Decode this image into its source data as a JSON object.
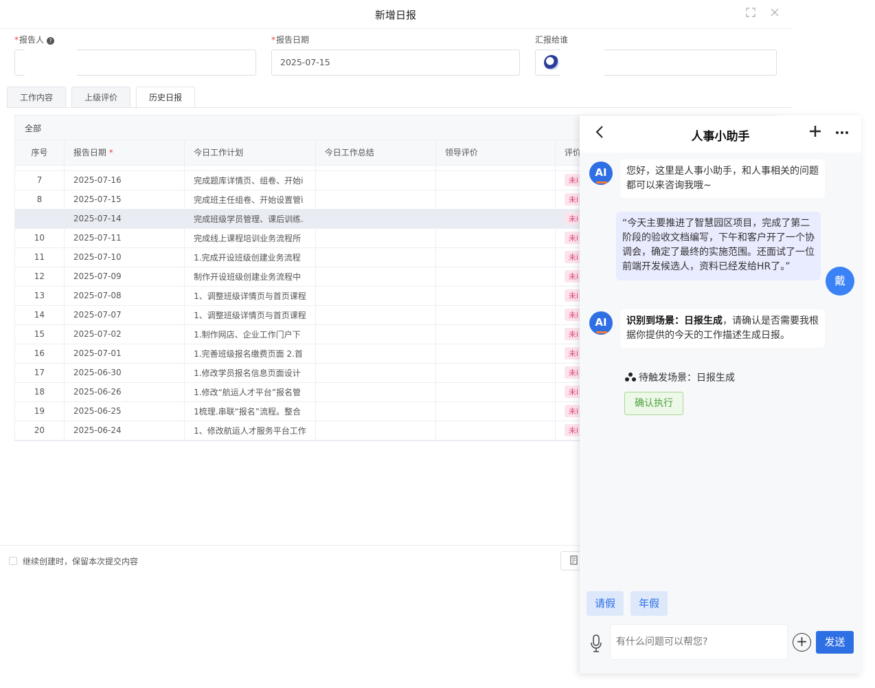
{
  "modal": {
    "title": "新增日报",
    "fields": {
      "reporter_label": "报告人",
      "report_date_label": "报告日期",
      "report_date_value": "2025-07-15",
      "report_to_label": "汇报给谁"
    },
    "tabs": [
      {
        "label": "工作内容"
      },
      {
        "label": "上级评价"
      },
      {
        "label": "历史日报"
      }
    ],
    "table": {
      "filter_label": "全部",
      "headers": [
        "序号",
        "报告日期",
        "今日工作计划",
        "今日工作总结",
        "领导评价",
        "评价"
      ],
      "rows": [
        {
          "no": "7",
          "date": "2025-07-16",
          "plan": "完成题库详情页、组卷、开始i",
          "status": "未i"
        },
        {
          "no": "8",
          "date": "2025-07-15",
          "plan": "完成班主任组卷、开始设置管ì",
          "status": "未i"
        },
        {
          "no": "",
          "date": "2025-07-14",
          "plan": "完成班级学员管理、课后训练.",
          "status": "未i"
        },
        {
          "no": "10",
          "date": "2025-07-11",
          "plan": "完成线上课程培训业务流程所",
          "status": "未i"
        },
        {
          "no": "11",
          "date": "2025-07-10",
          "plan": "1.完成开设班级创建业务流程",
          "status": "未i"
        },
        {
          "no": "12",
          "date": "2025-07-09",
          "plan": "制作开设班级创建业务流程中",
          "status": "未i"
        },
        {
          "no": "13",
          "date": "2025-07-08",
          "plan": "1、调整班级详情页与首页课程",
          "status": "未i"
        },
        {
          "no": "14",
          "date": "2025-07-07",
          "plan": "1、调整班级详情页与首页课程",
          "status": "未i"
        },
        {
          "no": "15",
          "date": "2025-07-02",
          "plan": "1.制作网店、企业工作门户下",
          "status": "未i"
        },
        {
          "no": "16",
          "date": "2025-07-01",
          "plan": "1.完善班级报名缴费页面 2.首",
          "status": "未i"
        },
        {
          "no": "17",
          "date": "2025-06-30",
          "plan": "1.修改学员报名信息页面设计",
          "status": "未i"
        },
        {
          "no": "18",
          "date": "2025-06-26",
          "plan": "1.修改“航运人才平台”报名管",
          "status": "未i"
        },
        {
          "no": "19",
          "date": "2025-06-25",
          "plan": "1梳理.串联“报名”流程。整合",
          "status": "未i"
        },
        {
          "no": "20",
          "date": "2025-06-24",
          "plan": "1、修改航运人才服务平台工作",
          "status": "未i"
        }
      ]
    },
    "footer": {
      "keep_label": "继续创建时，保留本次提交内容"
    }
  },
  "assistant": {
    "title": "人事小助手",
    "ai_avatar_text": "AI",
    "user_avatar_text": "戴",
    "messages": {
      "greeting": "您好，这里是人事小助手，和人事相关的问题都可以来咨询我哦~",
      "user_msg": "“今天主要推进了智慧园区项目，完成了第二阶段的验收文档编写，下午和客户开了一个协调会，确定了最终的实施范围。还面试了一位前端开发候选人，资料已经发给HR了。”",
      "scene_prefix": "识别到场景：日报生成",
      "scene_rest": "，请确认是否需要我根据你提供的今天的工作描述生成日报。"
    },
    "pending_label": "待触发场景：日报生成",
    "confirm_label": "确认执行",
    "quick_actions": [
      "请假",
      "年假"
    ],
    "input_placeholder": "有什么问题可以帮您?",
    "send_label": "发送"
  },
  "colors": {
    "primary": "#2f6fe4",
    "tag_bg": "#fde4ec",
    "tag_text": "#e0437a",
    "confirm_border": "#a7d894",
    "confirm_text": "#4aa33a"
  }
}
